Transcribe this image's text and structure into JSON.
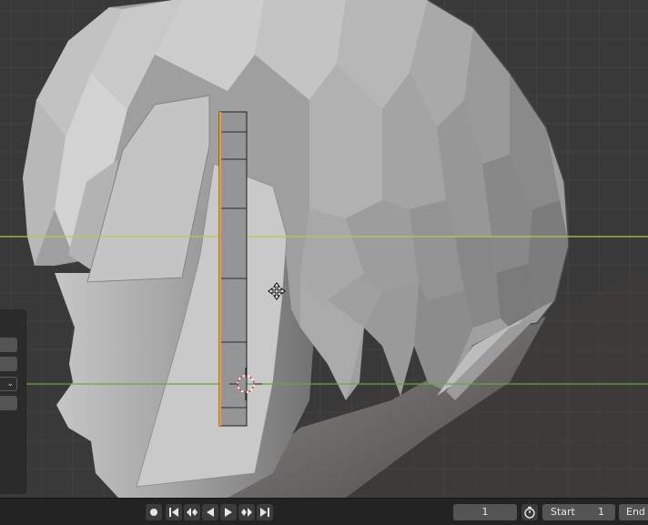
{
  "viewport": {
    "description_icons": [
      "move-gizmo-icon",
      "3d-cursor-icon"
    ],
    "colors": {
      "background": "#393939",
      "grid": "#454545",
      "x_axis": "#b5c94c",
      "y_axis": "#6ca33c",
      "selection": "#f29a32"
    }
  },
  "timeline": {
    "current_frame": "1",
    "start_label": "Start",
    "start_value": "1",
    "end_label": "End",
    "icons": [
      "keyframe-dot-icon",
      "jump-start-icon",
      "prev-keyframe-icon",
      "play-reverse-icon",
      "play-icon",
      "next-keyframe-icon",
      "jump-end-icon",
      "stopwatch-icon"
    ]
  }
}
